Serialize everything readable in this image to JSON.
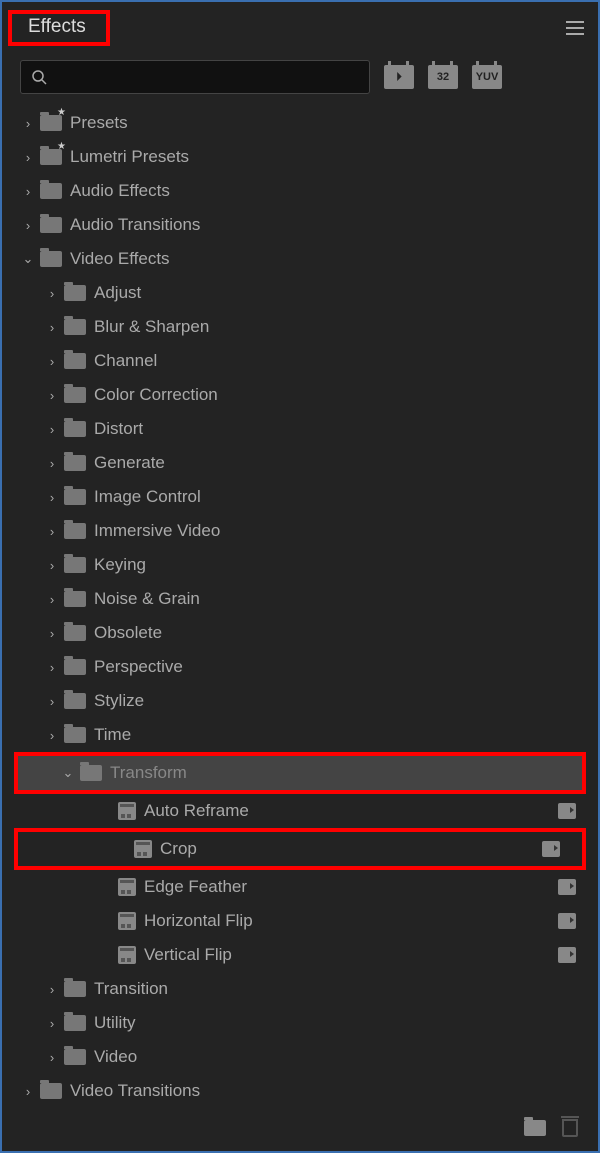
{
  "panel": {
    "title": "Effects",
    "search_placeholder": "",
    "badges": [
      "⏵",
      "32",
      "YUV"
    ]
  },
  "tree": [
    {
      "depth": 0,
      "chev": "right",
      "icon": "presets",
      "label": "Presets"
    },
    {
      "depth": 0,
      "chev": "right",
      "icon": "presets",
      "label": "Lumetri Presets"
    },
    {
      "depth": 0,
      "chev": "right",
      "icon": "folder",
      "label": "Audio Effects"
    },
    {
      "depth": 0,
      "chev": "right",
      "icon": "folder",
      "label": "Audio Transitions"
    },
    {
      "depth": 0,
      "chev": "down",
      "icon": "folder",
      "label": "Video Effects"
    },
    {
      "depth": 1,
      "chev": "right",
      "icon": "folder",
      "label": "Adjust"
    },
    {
      "depth": 1,
      "chev": "right",
      "icon": "folder",
      "label": "Blur & Sharpen"
    },
    {
      "depth": 1,
      "chev": "right",
      "icon": "folder",
      "label": "Channel"
    },
    {
      "depth": 1,
      "chev": "right",
      "icon": "folder",
      "label": "Color Correction"
    },
    {
      "depth": 1,
      "chev": "right",
      "icon": "folder",
      "label": "Distort"
    },
    {
      "depth": 1,
      "chev": "right",
      "icon": "folder",
      "label": "Generate"
    },
    {
      "depth": 1,
      "chev": "right",
      "icon": "folder",
      "label": "Image Control"
    },
    {
      "depth": 1,
      "chev": "right",
      "icon": "folder",
      "label": "Immersive Video"
    },
    {
      "depth": 1,
      "chev": "right",
      "icon": "folder",
      "label": "Keying"
    },
    {
      "depth": 1,
      "chev": "right",
      "icon": "folder",
      "label": "Noise & Grain"
    },
    {
      "depth": 1,
      "chev": "right",
      "icon": "folder",
      "label": "Obsolete"
    },
    {
      "depth": 1,
      "chev": "right",
      "icon": "folder",
      "label": "Perspective"
    },
    {
      "depth": 1,
      "chev": "right",
      "icon": "folder",
      "label": "Stylize"
    },
    {
      "depth": 1,
      "chev": "right",
      "icon": "folder",
      "label": "Time"
    },
    {
      "depth": 1,
      "chev": "down",
      "icon": "folder",
      "label": "Transform",
      "selected": true,
      "highlight": true
    },
    {
      "depth": 2,
      "chev": "",
      "icon": "preset",
      "label": "Auto Reframe",
      "accel": true
    },
    {
      "depth": 2,
      "chev": "",
      "icon": "preset",
      "label": "Crop",
      "accel": true,
      "highlight": true
    },
    {
      "depth": 2,
      "chev": "",
      "icon": "preset",
      "label": "Edge Feather",
      "accel": true
    },
    {
      "depth": 2,
      "chev": "",
      "icon": "preset",
      "label": "Horizontal Flip",
      "accel": true
    },
    {
      "depth": 2,
      "chev": "",
      "icon": "preset",
      "label": "Vertical Flip",
      "accel": true
    },
    {
      "depth": 1,
      "chev": "right",
      "icon": "folder",
      "label": "Transition"
    },
    {
      "depth": 1,
      "chev": "right",
      "icon": "folder",
      "label": "Utility"
    },
    {
      "depth": 1,
      "chev": "right",
      "icon": "folder",
      "label": "Video"
    },
    {
      "depth": 0,
      "chev": "right",
      "icon": "folder",
      "label": "Video Transitions"
    }
  ]
}
